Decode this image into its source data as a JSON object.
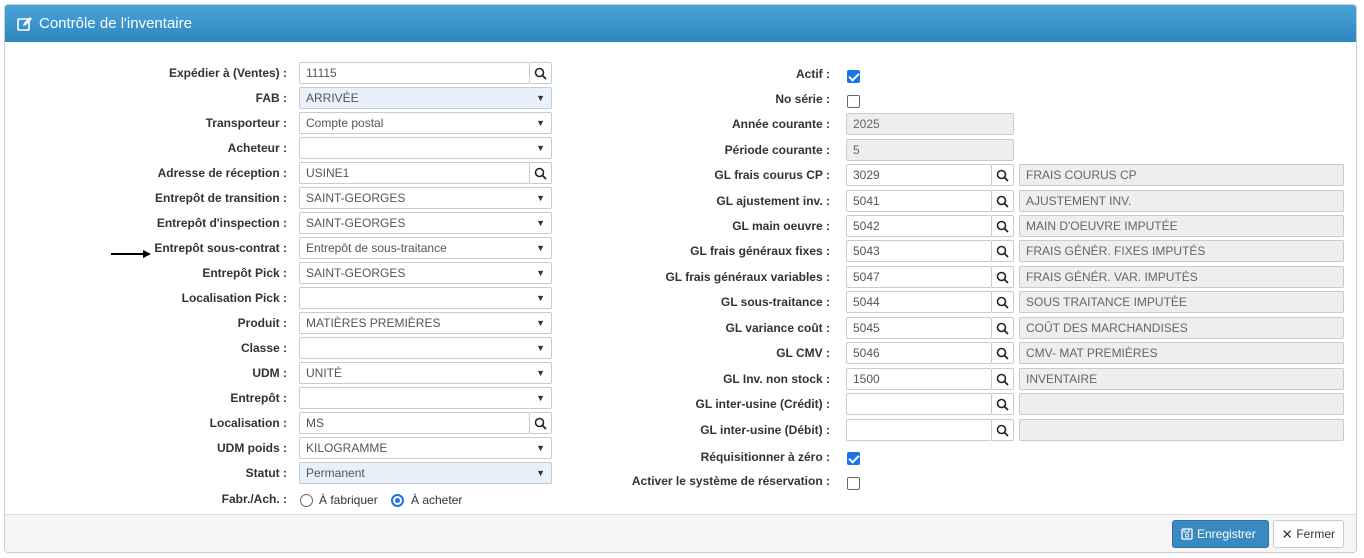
{
  "header": {
    "title": "Contrôle de l'inventaire",
    "icon": "edit-icon"
  },
  "left": {
    "expedier": {
      "label": "Expédier à (Ventes) :",
      "value": "11115"
    },
    "fab": {
      "label": "FAB :",
      "value": "ARRIVÉE"
    },
    "transporteur": {
      "label": "Transporteur :",
      "value": "Compte postal"
    },
    "acheteur": {
      "label": "Acheteur :",
      "value": ""
    },
    "adresse": {
      "label": "Adresse de réception :",
      "value": "USINE1"
    },
    "transition": {
      "label": "Entrepôt de transition :",
      "value": "SAINT-GEORGES"
    },
    "inspection": {
      "label": "Entrepôt d'inspection :",
      "value": "SAINT-GEORGES"
    },
    "souscontrat": {
      "label": "Entrepôt sous-contrat :",
      "value": "Entrepôt de sous-traitance"
    },
    "pick": {
      "label": "Entrepôt Pick :",
      "value": "SAINT-GEORGES"
    },
    "locpick": {
      "label": "Localisation Pick :",
      "value": ""
    },
    "produit": {
      "label": "Produit :",
      "value": "MATIÈRES PREMIÈRES"
    },
    "classe": {
      "label": "Classe :",
      "value": ""
    },
    "udm": {
      "label": "UDM :",
      "value": "UNITÉ"
    },
    "entrepot": {
      "label": "Entrepôt :",
      "value": ""
    },
    "localisation": {
      "label": "Localisation :",
      "value": "MS"
    },
    "udmpoids": {
      "label": "UDM poids :",
      "value": "KILOGRAMME"
    },
    "statut": {
      "label": "Statut :",
      "value": "Permanent"
    },
    "fabach": {
      "label": "Fabr./Ach. :",
      "opt1": "À fabriquer",
      "opt2": "À acheter",
      "selected": "À acheter"
    }
  },
  "right": {
    "actif": {
      "label": "Actif :",
      "checked": true
    },
    "noserie": {
      "label": "No série :",
      "checked": false
    },
    "annee": {
      "label": "Année courante :",
      "value": "2025"
    },
    "periode": {
      "label": "Période courante :",
      "value": "5"
    },
    "gl": [
      {
        "label": "GL frais courus CP :",
        "code": "3029",
        "desc": "FRAIS COURUS CP"
      },
      {
        "label": "GL ajustement inv. :",
        "code": "5041",
        "desc": "AJUSTEMENT INV."
      },
      {
        "label": "GL main oeuvre :",
        "code": "5042",
        "desc": "MAIN D'OEUVRE IMPUTÉE"
      },
      {
        "label": "GL frais généraux fixes :",
        "code": "5043",
        "desc": "FRAIS GÉNÉR. FIXES IMPUTÉS"
      },
      {
        "label": "GL frais généraux variables :",
        "code": "5047",
        "desc": "FRAIS GÉNÉR. VAR. IMPUTÉS"
      },
      {
        "label": "GL sous-traitance :",
        "code": "5044",
        "desc": "SOUS TRAITANCE IMPUTÉE"
      },
      {
        "label": "GL variance coût :",
        "code": "5045",
        "desc": "COÛT DES MARCHANDISES"
      },
      {
        "label": "GL CMV :",
        "code": "5046",
        "desc": "CMV- MAT PREMIÈRES"
      },
      {
        "label": "GL Inv. non stock :",
        "code": "1500",
        "desc": "INVENTAIRE"
      },
      {
        "label": "GL inter-usine (Crédit) :",
        "code": "",
        "desc": ""
      },
      {
        "label": "GL inter-usine (Débit) :",
        "code": "",
        "desc": ""
      }
    ],
    "requisitionner": {
      "label": "Réquisitionner à zéro :",
      "checked": true
    },
    "reservation": {
      "label": "Activer le système de réservation :",
      "checked": false
    }
  },
  "footer": {
    "save_label": "Enregistrer",
    "close_label": "Fermer"
  }
}
